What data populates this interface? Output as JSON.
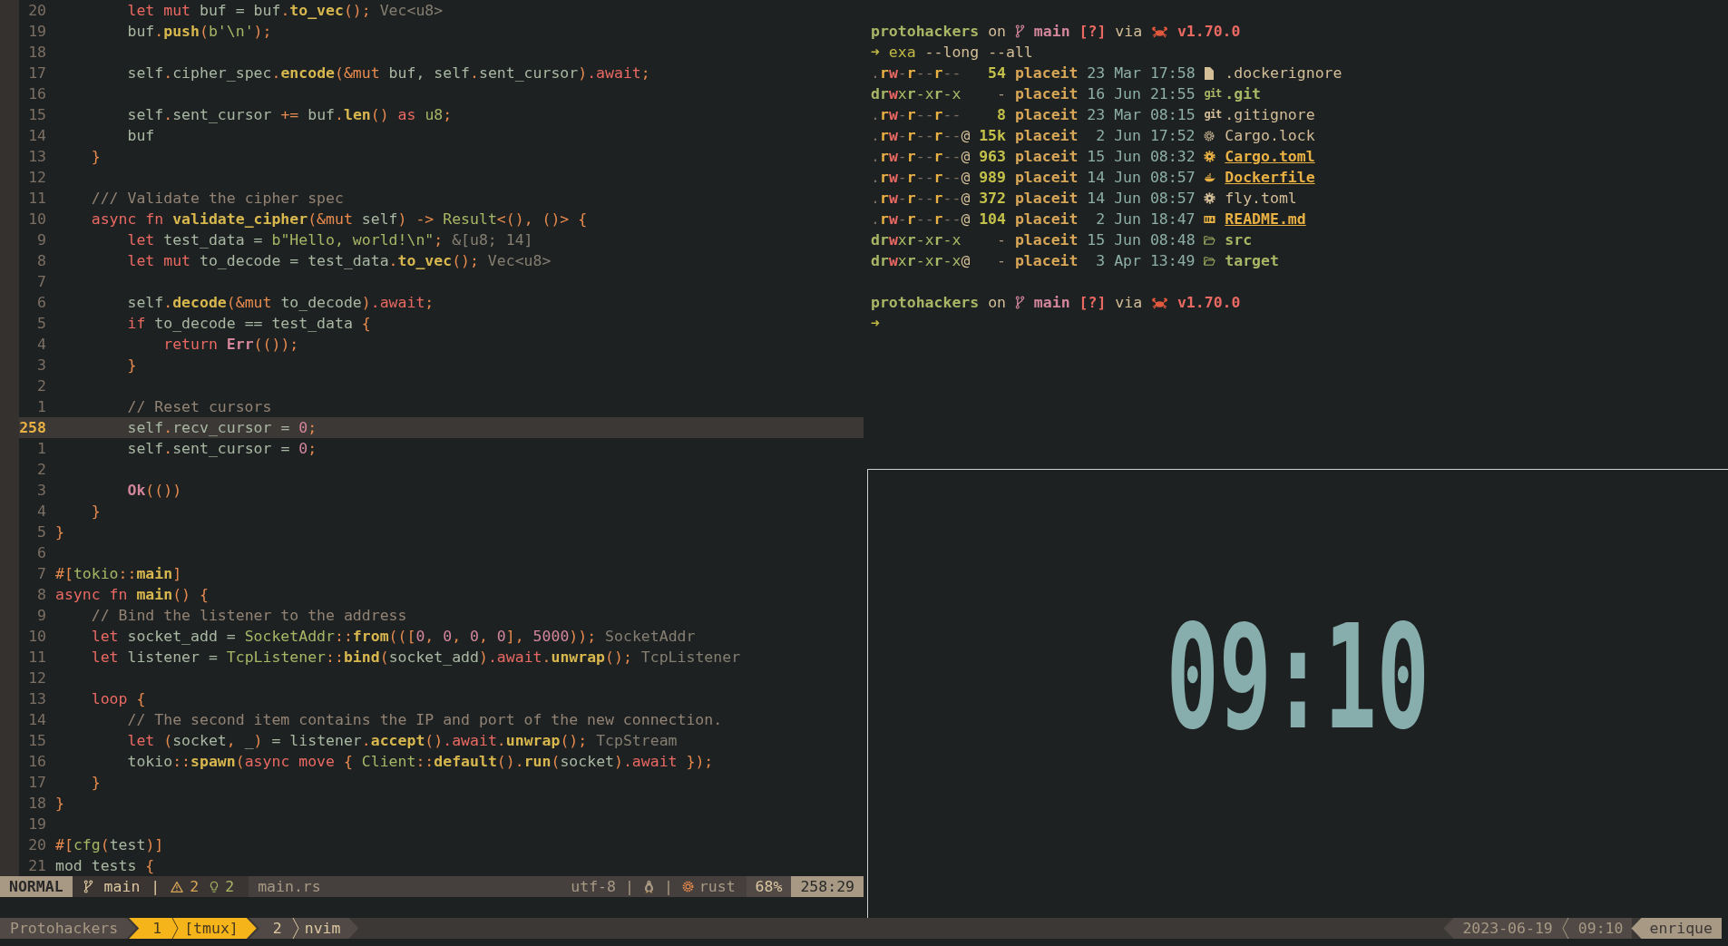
{
  "editor": {
    "lines": [
      {
        "number": "20",
        "current": false,
        "tokens": [
          {
            "kind": "keyword",
            "text": "        let mut"
          },
          {
            "kind": "name",
            "text": " buf = buf"
          },
          {
            "kind": "punct",
            "text": "."
          },
          {
            "kind": "function",
            "text": "to_vec"
          },
          {
            "kind": "punct",
            "text": "();"
          },
          {
            "kind": "hint",
            "text": " Vec<u8>"
          }
        ]
      },
      {
        "number": "19",
        "current": false,
        "tokens": [
          {
            "kind": "name",
            "text": "        buf"
          },
          {
            "kind": "punct",
            "text": "."
          },
          {
            "kind": "function",
            "text": "push"
          },
          {
            "kind": "punct",
            "text": "("
          },
          {
            "kind": "string",
            "text": "b'\\n'"
          },
          {
            "kind": "punct",
            "text": ");"
          }
        ]
      },
      {
        "number": "18",
        "current": false
      },
      {
        "number": "17",
        "current": false,
        "tokens": [
          {
            "kind": "name",
            "text": "        self"
          },
          {
            "kind": "punct",
            "text": "."
          },
          {
            "kind": "name",
            "text": "cipher_spec"
          },
          {
            "kind": "punct",
            "text": "."
          },
          {
            "kind": "function",
            "text": "encode"
          },
          {
            "kind": "punct",
            "text": "(&mut"
          },
          {
            "kind": "name",
            "text": " buf, self"
          },
          {
            "kind": "punct",
            "text": "."
          },
          {
            "kind": "name",
            "text": "sent_cursor"
          },
          {
            "kind": "punct",
            "text": ")"
          },
          {
            "kind": "keyword",
            "text": ".await"
          },
          {
            "kind": "punct",
            "text": ";"
          }
        ]
      },
      {
        "number": "16",
        "current": false
      },
      {
        "number": "15",
        "current": false,
        "tokens": [
          {
            "kind": "name",
            "text": "        self"
          },
          {
            "kind": "punct",
            "text": "."
          },
          {
            "kind": "name",
            "text": "sent_cursor"
          },
          {
            "kind": "punct",
            "text": " +="
          },
          {
            "kind": "name",
            "text": " buf"
          },
          {
            "kind": "punct",
            "text": "."
          },
          {
            "kind": "function",
            "text": "len"
          },
          {
            "kind": "punct",
            "text": "()"
          },
          {
            "kind": "keyword",
            "text": " as"
          },
          {
            "kind": "type",
            "text": " u8"
          },
          {
            "kind": "punct",
            "text": ";"
          }
        ]
      },
      {
        "number": "14",
        "current": false,
        "tokens": [
          {
            "kind": "name",
            "text": "        buf"
          }
        ]
      },
      {
        "number": "13",
        "current": false,
        "tokens": [
          {
            "kind": "punct",
            "text": "    }"
          }
        ]
      },
      {
        "number": "12",
        "current": false
      },
      {
        "number": "11",
        "current": false,
        "tokens": [
          {
            "kind": "comment",
            "text": "    /// Validate the cipher spec"
          }
        ]
      },
      {
        "number": "10",
        "current": false,
        "tokens": [
          {
            "kind": "keyword",
            "text": "    async fn"
          },
          {
            "kind": "function",
            "text": " validate_cipher"
          },
          {
            "kind": "punct",
            "text": "(&mut"
          },
          {
            "kind": "name",
            "text": " self"
          },
          {
            "kind": "punct",
            "text": ") ->"
          },
          {
            "kind": "type",
            "text": " Result"
          },
          {
            "kind": "punct",
            "text": "<(), ()> {"
          }
        ]
      },
      {
        "number": "9",
        "current": false,
        "tokens": [
          {
            "kind": "keyword",
            "text": "        let"
          },
          {
            "kind": "name",
            "text": " test_data ="
          },
          {
            "kind": "string",
            "text": " b\"Hello, world!\\n\""
          },
          {
            "kind": "punct",
            "text": ";"
          },
          {
            "kind": "hint",
            "text": " &[u8; 14]"
          }
        ]
      },
      {
        "number": "8",
        "current": false,
        "tokens": [
          {
            "kind": "keyword",
            "text": "        let mut"
          },
          {
            "kind": "name",
            "text": " to_decode = test_data"
          },
          {
            "kind": "punct",
            "text": "."
          },
          {
            "kind": "function",
            "text": "to_vec"
          },
          {
            "kind": "punct",
            "text": "();"
          },
          {
            "kind": "hint",
            "text": " Vec<u8>"
          }
        ]
      },
      {
        "number": "7",
        "current": false
      },
      {
        "number": "6",
        "current": false,
        "tokens": [
          {
            "kind": "name",
            "text": "        self"
          },
          {
            "kind": "punct",
            "text": "."
          },
          {
            "kind": "function",
            "text": "decode"
          },
          {
            "kind": "punct",
            "text": "(&mut"
          },
          {
            "kind": "name",
            "text": " to_decode"
          },
          {
            "kind": "punct",
            "text": ")"
          },
          {
            "kind": "keyword",
            "text": ".await"
          },
          {
            "kind": "punct",
            "text": ";"
          }
        ]
      },
      {
        "number": "5",
        "current": false,
        "tokens": [
          {
            "kind": "keyword",
            "text": "        if"
          },
          {
            "kind": "name",
            "text": " to_decode == test_data"
          },
          {
            "kind": "punct",
            "text": " {"
          }
        ]
      },
      {
        "number": "4",
        "current": false,
        "tokens": [
          {
            "kind": "keyword",
            "text": "            return"
          },
          {
            "kind": "constant",
            "text": " Err"
          },
          {
            "kind": "punct",
            "text": "(());"
          }
        ]
      },
      {
        "number": "3",
        "current": false,
        "tokens": [
          {
            "kind": "punct",
            "text": "        }"
          }
        ]
      },
      {
        "number": "2",
        "current": false
      },
      {
        "number": "1",
        "current": false,
        "tokens": [
          {
            "kind": "comment",
            "text": "        // Reset cursors"
          }
        ]
      },
      {
        "number": "258",
        "current": true,
        "tokens": [
          {
            "kind": "name",
            "text": "        self"
          },
          {
            "kind": "punct",
            "text": "."
          },
          {
            "kind": "name",
            "text": "recv_cursor ="
          },
          {
            "kind": "number",
            "text": " 0"
          },
          {
            "kind": "punct",
            "text": ";"
          }
        ]
      },
      {
        "number": "1",
        "current": false,
        "tokens": [
          {
            "kind": "name",
            "text": "        self"
          },
          {
            "kind": "punct",
            "text": "."
          },
          {
            "kind": "name",
            "text": "sent_cursor ="
          },
          {
            "kind": "number",
            "text": " 0"
          },
          {
            "kind": "punct",
            "text": ";"
          }
        ]
      },
      {
        "number": "2",
        "current": false
      },
      {
        "number": "3",
        "current": false,
        "tokens": [
          {
            "kind": "constant",
            "text": "        Ok"
          },
          {
            "kind": "punct",
            "text": "(())"
          }
        ]
      },
      {
        "number": "4",
        "current": false,
        "tokens": [
          {
            "kind": "punct",
            "text": "    }"
          }
        ]
      },
      {
        "number": "5",
        "current": false,
        "tokens": [
          {
            "kind": "punct",
            "text": "}"
          }
        ]
      },
      {
        "number": "6",
        "current": false
      },
      {
        "number": "7",
        "current": false,
        "tokens": [
          {
            "kind": "punct",
            "text": "#["
          },
          {
            "kind": "type",
            "text": "tokio"
          },
          {
            "kind": "punct",
            "text": "::"
          },
          {
            "kind": "function",
            "text": "main"
          },
          {
            "kind": "punct",
            "text": "]"
          }
        ]
      },
      {
        "number": "8",
        "current": false,
        "tokens": [
          {
            "kind": "keyword",
            "text": "async fn"
          },
          {
            "kind": "function",
            "text": " main"
          },
          {
            "kind": "punct",
            "text": "() {"
          }
        ]
      },
      {
        "number": "9",
        "current": false,
        "tokens": [
          {
            "kind": "comment",
            "text": "    // Bind the listener to the address"
          }
        ]
      },
      {
        "number": "10",
        "current": false,
        "tokens": [
          {
            "kind": "keyword",
            "text": "    let"
          },
          {
            "kind": "name",
            "text": " socket_add ="
          },
          {
            "kind": "type",
            "text": " SocketAddr"
          },
          {
            "kind": "punct",
            "text": "::"
          },
          {
            "kind": "function",
            "text": "from"
          },
          {
            "kind": "punct",
            "text": "(("
          },
          {
            "kind": "punct",
            "text": "["
          },
          {
            "kind": "number",
            "text": "0"
          },
          {
            "kind": "punct",
            "text": ","
          },
          {
            "kind": "number",
            "text": " 0"
          },
          {
            "kind": "punct",
            "text": ","
          },
          {
            "kind": "number",
            "text": " 0"
          },
          {
            "kind": "punct",
            "text": ","
          },
          {
            "kind": "number",
            "text": " 0"
          },
          {
            "kind": "punct",
            "text": "],"
          },
          {
            "kind": "number",
            "text": " 5000"
          },
          {
            "kind": "punct",
            "text": "));"
          },
          {
            "kind": "hint",
            "text": " SocketAddr"
          }
        ]
      },
      {
        "number": "11",
        "current": false,
        "tokens": [
          {
            "kind": "keyword",
            "text": "    let"
          },
          {
            "kind": "name",
            "text": " listener ="
          },
          {
            "kind": "type",
            "text": " TcpListener"
          },
          {
            "kind": "punct",
            "text": "::"
          },
          {
            "kind": "function",
            "text": "bind"
          },
          {
            "kind": "punct",
            "text": "("
          },
          {
            "kind": "name",
            "text": "socket_add"
          },
          {
            "kind": "punct",
            "text": ")"
          },
          {
            "kind": "keyword",
            "text": ".await"
          },
          {
            "kind": "punct",
            "text": "."
          },
          {
            "kind": "function",
            "text": "unwrap"
          },
          {
            "kind": "punct",
            "text": "();"
          },
          {
            "kind": "hint",
            "text": " TcpListener"
          }
        ]
      },
      {
        "number": "12",
        "current": false
      },
      {
        "number": "13",
        "current": false,
        "tokens": [
          {
            "kind": "keyword",
            "text": "    loop"
          },
          {
            "kind": "punct",
            "text": " {"
          }
        ]
      },
      {
        "number": "14",
        "current": false,
        "tokens": [
          {
            "kind": "comment",
            "text": "        // The second item contains the IP and port of the new connection."
          }
        ]
      },
      {
        "number": "15",
        "current": false,
        "tokens": [
          {
            "kind": "keyword",
            "text": "        let"
          },
          {
            "kind": "punct",
            "text": " ("
          },
          {
            "kind": "name",
            "text": "socket"
          },
          {
            "kind": "punct",
            "text": ","
          },
          {
            "kind": "name",
            "text": " _"
          },
          {
            "kind": "punct",
            "text": ")"
          },
          {
            "kind": "name",
            "text": " = listener"
          },
          {
            "kind": "punct",
            "text": "."
          },
          {
            "kind": "function",
            "text": "accept"
          },
          {
            "kind": "punct",
            "text": "()"
          },
          {
            "kind": "keyword",
            "text": ".await"
          },
          {
            "kind": "punct",
            "text": "."
          },
          {
            "kind": "function",
            "text": "unwrap"
          },
          {
            "kind": "punct",
            "text": "();"
          },
          {
            "kind": "hint",
            "text": " TcpStream"
          }
        ]
      },
      {
        "number": "16",
        "current": false,
        "tokens": [
          {
            "kind": "name",
            "text": "        tokio"
          },
          {
            "kind": "punct",
            "text": "::"
          },
          {
            "kind": "function",
            "text": "spawn"
          },
          {
            "kind": "punct",
            "text": "("
          },
          {
            "kind": "keyword",
            "text": "async move"
          },
          {
            "kind": "punct",
            "text": " {"
          },
          {
            "kind": "type",
            "text": " Client"
          },
          {
            "kind": "punct",
            "text": "::"
          },
          {
            "kind": "function",
            "text": "default"
          },
          {
            "kind": "punct",
            "text": "()."
          },
          {
            "kind": "function",
            "text": "run"
          },
          {
            "kind": "punct",
            "text": "("
          },
          {
            "kind": "name",
            "text": "socket"
          },
          {
            "kind": "punct",
            "text": ")"
          },
          {
            "kind": "keyword",
            "text": ".await"
          },
          {
            "kind": "punct",
            "text": " });"
          }
        ]
      },
      {
        "number": "17",
        "current": false,
        "tokens": [
          {
            "kind": "punct",
            "text": "    }"
          }
        ]
      },
      {
        "number": "18",
        "current": false,
        "tokens": [
          {
            "kind": "punct",
            "text": "}"
          }
        ]
      },
      {
        "number": "19",
        "current": false
      },
      {
        "number": "20",
        "current": false,
        "tokens": [
          {
            "kind": "punct",
            "text": "#["
          },
          {
            "kind": "type",
            "text": "cfg"
          },
          {
            "kind": "punct",
            "text": "("
          },
          {
            "kind": "name",
            "text": "test"
          },
          {
            "kind": "punct",
            "text": ")]"
          }
        ]
      },
      {
        "number": "21",
        "current": false,
        "tokens": [
          {
            "kind": "name",
            "text": "mod tests"
          },
          {
            "kind": "punct",
            "text": " {"
          }
        ]
      }
    ],
    "statusline": {
      "mode": "NORMAL",
      "branch": "main",
      "branch_separator": "|",
      "warnings": "2",
      "hints": "2",
      "file": "main.rs",
      "encoding": "utf-8",
      "encoding_separator": "|",
      "os_separator": "|",
      "filetype": "rust",
      "progress": "68%",
      "position": "258:29"
    }
  },
  "terminal": {
    "blocks": [
      {
        "prompt": {
          "directory": "protohackers",
          "on": "on",
          "branch": "main",
          "status": "[?]",
          "via": "via",
          "version": "v1.70.0"
        },
        "command": {
          "symbol": "➜",
          "program": "exa",
          "arguments": "--long --all"
        },
        "entries": [
          {
            "permissions": ".rw-r--r--",
            "size": "54",
            "owner": "placeit",
            "date": "23 Mar 17:58",
            "name": ".dockerignore",
            "kind": "file"
          },
          {
            "permissions": "drwxr-xr-x",
            "size": "-",
            "owner": "placeit",
            "date": "16 Jun 21:55",
            "icon_text": "git",
            "name": ".git",
            "kind": "directory"
          },
          {
            "permissions": ".rw-r--r--",
            "size": "8",
            "owner": "placeit",
            "date": "23 Mar 08:15",
            "icon_text": "git",
            "name": ".gitignore",
            "kind": "file"
          },
          {
            "permissions": ".rw-r--r--@",
            "size": "15k",
            "owner": "placeit",
            "date": "2 Jun 17:52",
            "name": "Cargo.lock",
            "kind": "file"
          },
          {
            "permissions": ".rw-r--r--@",
            "size": "963",
            "owner": "placeit",
            "date": "15 Jun 08:32",
            "name": "Cargo.toml",
            "kind": "special"
          },
          {
            "permissions": ".rw-r--r--@",
            "size": "989",
            "owner": "placeit",
            "date": "14 Jun 08:57",
            "name": "Dockerfile",
            "kind": "special"
          },
          {
            "permissions": ".rw-r--r--@",
            "size": "372",
            "owner": "placeit",
            "date": "14 Jun 08:57",
            "name": "fly.toml",
            "kind": "file"
          },
          {
            "permissions": ".rw-r--r--@",
            "size": "104",
            "owner": "placeit",
            "date": "2 Jun 18:47",
            "name": "README.md",
            "kind": "special"
          },
          {
            "permissions": "drwxr-xr-x",
            "size": "-",
            "owner": "placeit",
            "date": "15 Jun 08:48",
            "name": "src",
            "kind": "directory"
          },
          {
            "permissions": "drwxr-xr-x@",
            "size": "-",
            "owner": "placeit",
            "date": "3 Apr 13:49",
            "name": "target",
            "kind": "directory"
          }
        ]
      },
      {
        "prompt": {
          "directory": "protohackers",
          "on": "on",
          "branch": "main",
          "status": "[?]",
          "via": "via",
          "version": "v1.70.0"
        },
        "command": {
          "symbol": "➜"
        }
      }
    ]
  },
  "clock": {
    "time": "09:10"
  },
  "tmux": {
    "session": "Protohackers",
    "windows": [
      {
        "index": "1",
        "name": "[tmux]",
        "selected": true
      },
      {
        "index": "2",
        "name": "nvim",
        "selected": false
      }
    ],
    "date": "2023-06-19",
    "time": "09:10",
    "user": "enrique"
  }
}
